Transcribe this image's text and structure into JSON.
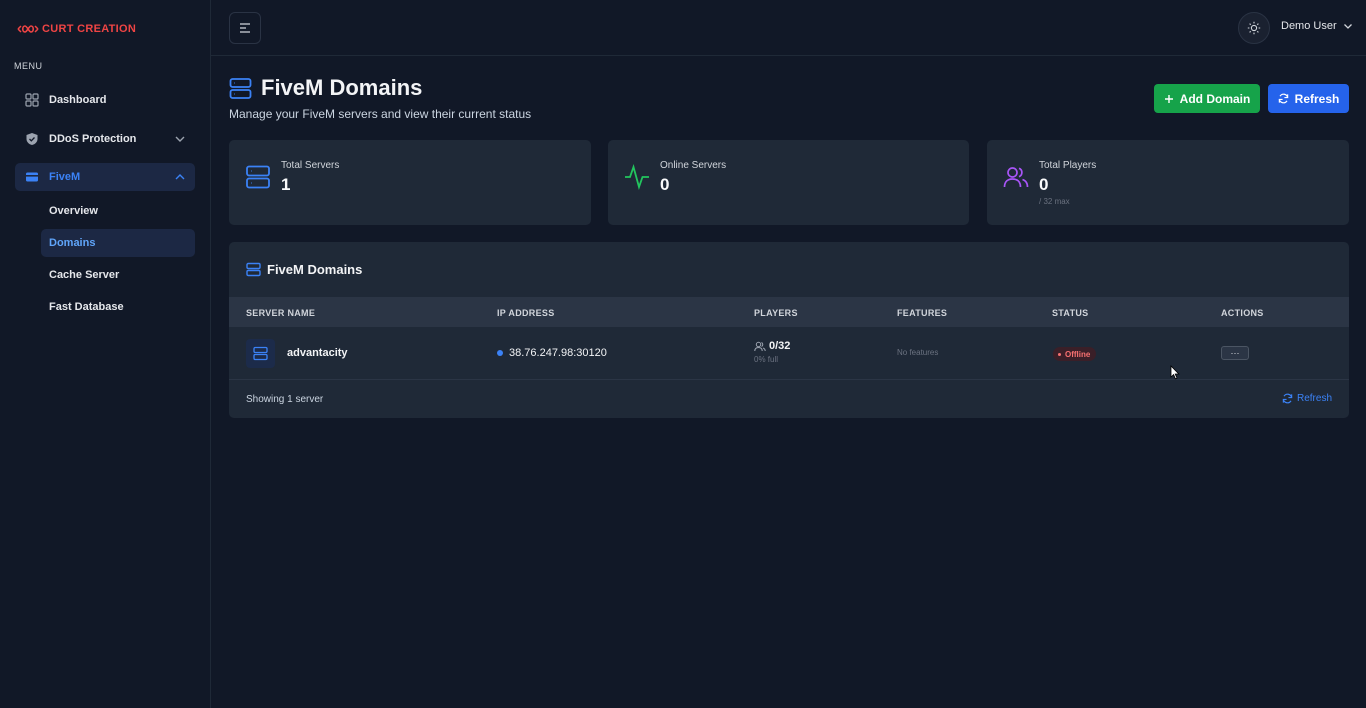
{
  "brand": {
    "logo_text": "CURT CREATION",
    "accent": "#ef4444"
  },
  "sidebar": {
    "menu_label": "MENU",
    "items": [
      {
        "label": "Dashboard",
        "icon": "grid-icon"
      },
      {
        "label": "DDoS Protection",
        "icon": "shield-check-icon"
      },
      {
        "label": "FiveM",
        "icon": "credit-card-icon"
      }
    ],
    "fivem_children": [
      {
        "label": "Overview"
      },
      {
        "label": "Domains"
      },
      {
        "label": "Cache Server"
      },
      {
        "label": "Fast Database"
      }
    ]
  },
  "topbar": {
    "user_name": "Demo User"
  },
  "header": {
    "title": "FiveM Domains",
    "subtitle": "Manage your FiveM servers and view their current status",
    "add_label": "Add Domain",
    "refresh_label": "Refresh"
  },
  "stats": {
    "total_servers": {
      "label": "Total Servers",
      "value": "1"
    },
    "online_servers": {
      "label": "Online Servers",
      "value": "0"
    },
    "total_players": {
      "label": "Total Players",
      "value": "0",
      "sub": "/ 32 max"
    }
  },
  "table": {
    "title": "FiveM Domains",
    "columns": [
      "SERVER NAME",
      "IP ADDRESS",
      "PLAYERS",
      "FEATURES",
      "STATUS",
      "ACTIONS"
    ],
    "rows": [
      {
        "name": "advantacity",
        "ip": "38.76.247.98:30120",
        "players": "0/32",
        "players_pct": "0% full",
        "features": "No features",
        "status": "Offline",
        "actions": "···"
      }
    ],
    "footer_text": "Showing 1 server",
    "footer_refresh": "Refresh"
  },
  "colors": {
    "background": "#111827",
    "card": "#1f2937",
    "primary": "#2563eb",
    "success": "#16a34a",
    "danger": "#f87171",
    "players_icon": "#a855f7"
  }
}
